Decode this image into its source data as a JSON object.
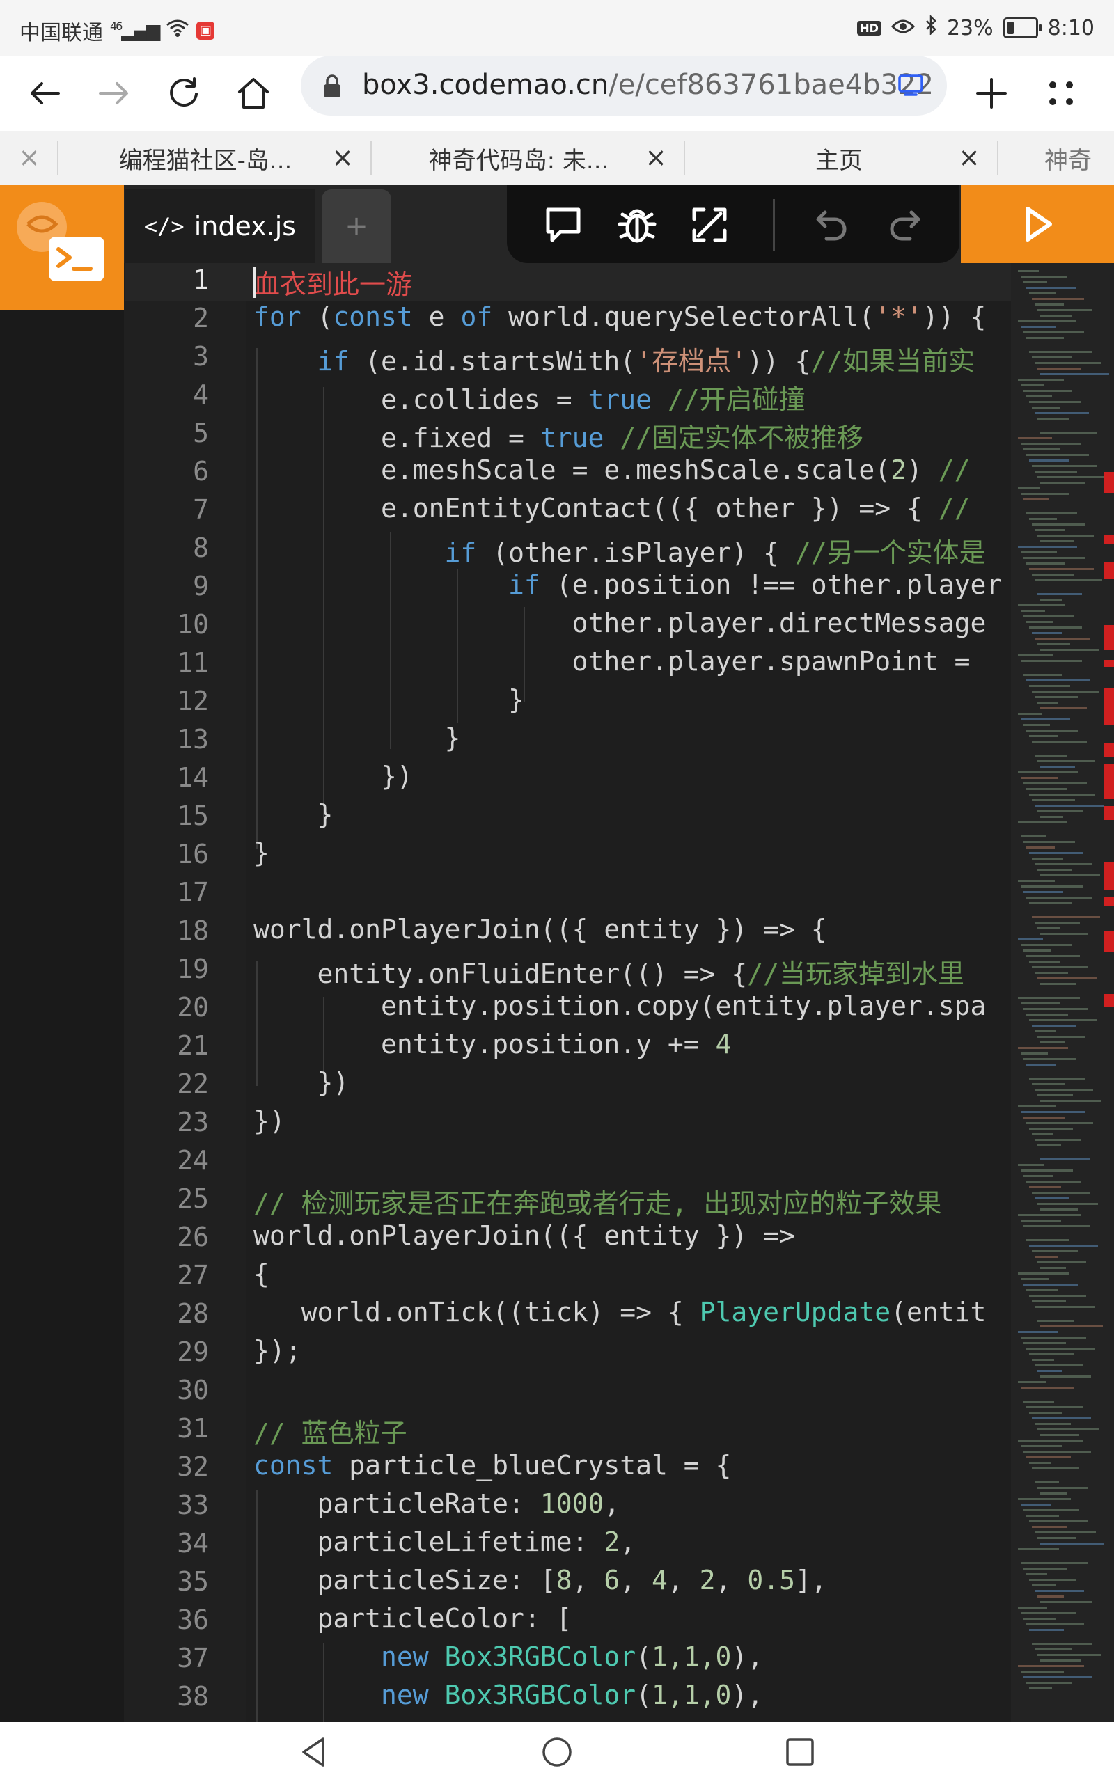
{
  "status_bar": {
    "carrier": "中国联通",
    "network": "46",
    "battery": "23%",
    "time": "8:10",
    "hd_badge": "HD",
    "icons": [
      "signal-icon",
      "wifi-icon",
      "notification-icon",
      "hd-icon",
      "eye-icon",
      "bluetooth-icon",
      "battery-icon"
    ]
  },
  "browser": {
    "url_host": "box3.codemao.cn",
    "url_path": "/e/cef863761bae4b322",
    "icons": [
      "back-icon",
      "forward-icon",
      "reload-icon",
      "home-icon",
      "lock-icon",
      "device-icon",
      "new-tab-icon",
      "menu-icon"
    ]
  },
  "tabs": [
    {
      "title": "编程猫社区-岛..."
    },
    {
      "title": "神奇代码岛: 未..."
    },
    {
      "title": "主页"
    },
    {
      "title": "神奇"
    }
  ],
  "editor": {
    "file_tab": "index.js",
    "add_tab": "+",
    "tools": [
      "chat-icon",
      "debug-bug-icon",
      "expand-icon",
      "undo-icon",
      "redo-icon",
      "run-icon"
    ]
  },
  "code_lines": [
    {
      "n": "1"
    },
    {
      "n": "2"
    },
    {
      "n": "3"
    },
    {
      "n": "4"
    },
    {
      "n": "5"
    },
    {
      "n": "6"
    },
    {
      "n": "7"
    },
    {
      "n": "8"
    },
    {
      "n": "9"
    },
    {
      "n": "10"
    },
    {
      "n": "11"
    },
    {
      "n": "12"
    },
    {
      "n": "13"
    },
    {
      "n": "14"
    },
    {
      "n": "15"
    },
    {
      "n": "16"
    },
    {
      "n": "17"
    },
    {
      "n": "18"
    },
    {
      "n": "19"
    },
    {
      "n": "20"
    },
    {
      "n": "21"
    },
    {
      "n": "22"
    },
    {
      "n": "23"
    },
    {
      "n": "24"
    },
    {
      "n": "25"
    },
    {
      "n": "26"
    },
    {
      "n": "27"
    },
    {
      "n": "28"
    },
    {
      "n": "29"
    },
    {
      "n": "30"
    },
    {
      "n": "31"
    },
    {
      "n": "32"
    },
    {
      "n": "33"
    },
    {
      "n": "34"
    },
    {
      "n": "35"
    },
    {
      "n": "36"
    },
    {
      "n": "37"
    },
    {
      "n": "38"
    }
  ],
  "code": {
    "l1": "血衣到此一游",
    "l2_kw1": "for",
    "l2_a": " (",
    "l2_kw2": "const",
    "l2_b": " e ",
    "l2_kw3": "of",
    "l2_c": " world.querySelectorAll(",
    "l2_str": "'*'",
    "l2_d": ")) {",
    "l3_kw": "if",
    "l3_a": " (e.id.startsWith(",
    "l3_str": "'存档点'",
    "l3_b": ")) {",
    "l3_cm": "//如果当前实",
    "l4_a": "e.collides = ",
    "l4_kw": "true",
    "l4_cm": " //开启碰撞",
    "l5_a": "e.fixed = ",
    "l5_kw": "true",
    "l5_cm": " //固定实体不被推移",
    "l6_a": "e.meshScale = e.meshScale.scale(",
    "l6_num": "2",
    "l6_b": ") ",
    "l6_cm": "//",
    "l7_a": "e.onEntityContact(({ other }) => { ",
    "l7_cm": "//",
    "l8_kw": "if",
    "l8_a": " (other.isPlayer) { ",
    "l8_cm": "//另一个实体是",
    "l9_kw": "if",
    "l9_a": " (e.position !== other.player",
    "l10": "other.player.directMessage",
    "l11": "other.player.spawnPoint = ",
    "l12": "}",
    "l13": "}",
    "l14": "})",
    "l15": "}",
    "l16": "}",
    "l18": "world.onPlayerJoin(({ entity }) => {",
    "l19_a": "entity.onFluidEnter(() => {",
    "l19_cm": "//当玩家掉到水里",
    "l20": "entity.position.copy(entity.player.spa",
    "l21_a": "entity.position.y += ",
    "l21_num": "4",
    "l22": "})",
    "l23": "})",
    "l25_cm": "// 检测玩家是否正在奔跑或者行走, 出现对应的粒子效果",
    "l26": "world.onPlayerJoin(({ entity }) =>",
    "l27": "{",
    "l28_a": "world.onTick((tick) => { ",
    "l28_ty": "PlayerUpdate",
    "l28_b": "(entit",
    "l29": "});",
    "l31_cm": "// 蓝色粒子",
    "l32_kw": "const",
    "l32_a": " particle_blueCrystal = {",
    "l33_a": "particleRate: ",
    "l33_num": "1000",
    "l33_b": ",",
    "l34_a": "particleLifetime: ",
    "l34_num": "2",
    "l34_b": ",",
    "l35_a": "particleSize: [",
    "l35_n1": "8",
    "l35_s1": ", ",
    "l35_n2": "6",
    "l35_s2": ", ",
    "l35_n3": "4",
    "l35_s3": ", ",
    "l35_n4": "2",
    "l35_s4": ", ",
    "l35_n5": "0.5",
    "l35_b": "],",
    "l36": "particleColor: [",
    "l37_kw": "new",
    "l37_ty": " Box3RGBColor",
    "l37_a": "(",
    "l37_num": "1,1,0",
    "l37_b": "),",
    "l38_kw": "new",
    "l38_ty": " Box3RGBColor",
    "l38_a": "(",
    "l38_num": "1,1,0",
    "l38_b": "),"
  },
  "nav_bar": {
    "icons": [
      "nav-back-icon",
      "nav-home-icon",
      "nav-recents-icon"
    ]
  },
  "colors": {
    "accent_orange": "#f28c19",
    "editor_bg": "#1e1e1e",
    "keyword": "#569cd6",
    "comment": "#6a9955",
    "string": "#ce9178",
    "number": "#b5cea8",
    "type": "#4ec9b0",
    "error_red": "#e14c4c"
  }
}
